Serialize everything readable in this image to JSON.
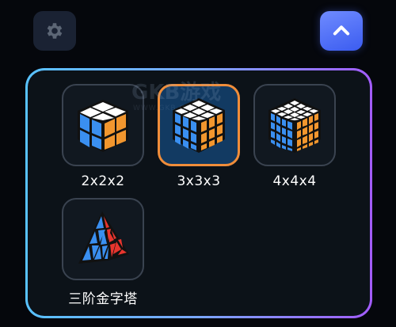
{
  "toolbar": {
    "settings_icon": "gear-icon",
    "collapse_icon": "chevron-up-icon",
    "accent": "#4f6cff"
  },
  "puzzles": [
    {
      "label": "2x2x2",
      "icon": "cube-2x2-icon",
      "selected": false
    },
    {
      "label": "3x3x3",
      "icon": "cube-3x3-icon",
      "selected": true
    },
    {
      "label": "4x4x4",
      "icon": "cube-4x4-icon",
      "selected": false
    },
    {
      "label": "三阶金字塔",
      "icon": "pyraminx-icon",
      "selected": false
    }
  ],
  "watermark": {
    "text": "GKB游戏",
    "sub": "WWW.GKB.COM"
  },
  "colors": {
    "selected_border": "#f08d3a",
    "panel_gradient": [
      "#58c2ff",
      "#a35cff"
    ],
    "cube_white": "#ffffff",
    "cube_blue": "#3a8ff0",
    "cube_orange": "#f2962e"
  }
}
